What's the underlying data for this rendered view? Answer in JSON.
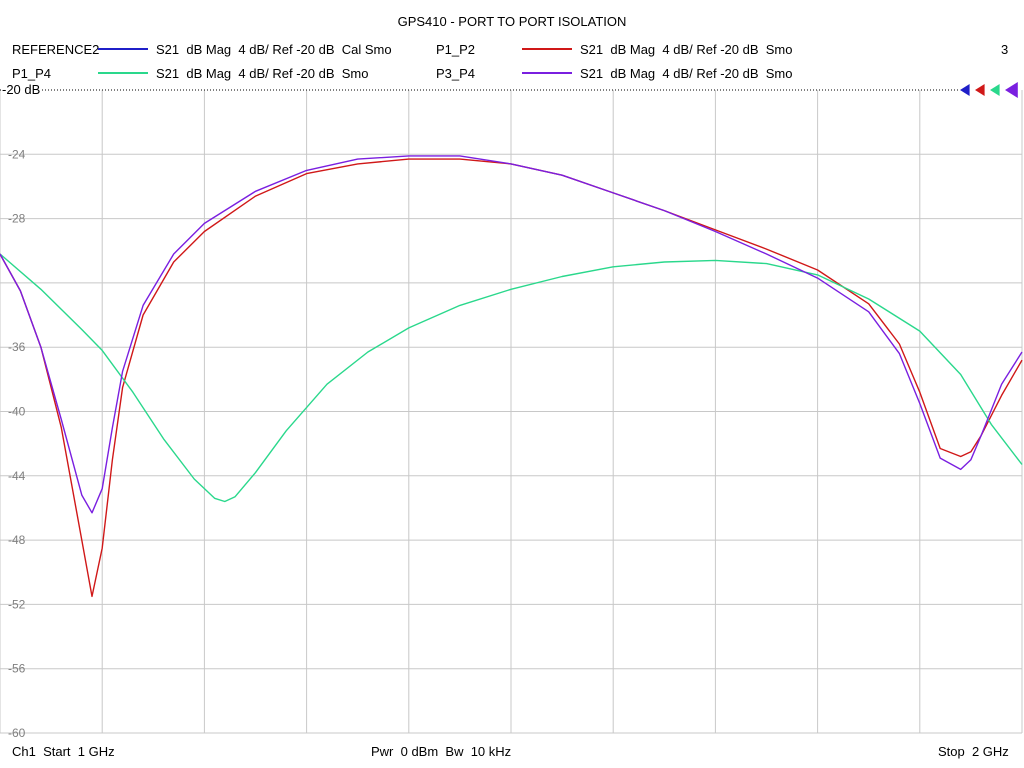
{
  "title": "GPS410 - PORT TO PORT ISOLATION",
  "channel_number": "3",
  "ref_label": "-20 dB",
  "legend": [
    {
      "name": "REFERENCE2",
      "desc": "S21  dB Mag  4 dB/ Ref -20 dB  Cal Smo",
      "color": "#1f1fc8"
    },
    {
      "name": "P1_P2",
      "desc": "S21  dB Mag  4 dB/ Ref -20 dB  Smo",
      "color": "#d01818"
    },
    {
      "name": "P1_P4",
      "desc": "S21  dB Mag  4 dB/ Ref -20 dB  Smo",
      "color": "#2ad88c"
    },
    {
      "name": "P3_P4",
      "desc": "S21  dB Mag  4 dB/ Ref -20 dB  Smo",
      "color": "#7a1fe0"
    }
  ],
  "footer": {
    "left": "Ch1  Start  1 GHz",
    "center": "Pwr  0 dBm  Bw  10 kHz",
    "right": "Stop  2 GHz"
  },
  "chart_data": {
    "type": "line",
    "title": "GPS410 - PORT TO PORT ISOLATION",
    "xlabel": "",
    "ylabel": "",
    "x_unit": "GHz",
    "xlim": [
      1.0,
      2.0
    ],
    "ylim": [
      -60,
      -20
    ],
    "y_ticks": [
      -20,
      -24,
      -28,
      -32,
      -36,
      -40,
      -44,
      -48,
      -52,
      -56,
      -60
    ],
    "y_tick_labels": [
      "-20",
      "-24",
      "-28",
      "",
      "-36",
      "-40",
      "-44",
      "-48",
      "-52",
      "-56",
      "-60"
    ],
    "x_gridlines": 10,
    "grid": true,
    "series": [
      {
        "name": "P1_P2",
        "color": "#d01818",
        "x": [
          1.0,
          1.02,
          1.04,
          1.06,
          1.08,
          1.09,
          1.1,
          1.11,
          1.12,
          1.14,
          1.17,
          1.2,
          1.25,
          1.3,
          1.35,
          1.4,
          1.45,
          1.5,
          1.55,
          1.6,
          1.65,
          1.7,
          1.75,
          1.8,
          1.85,
          1.88,
          1.9,
          1.92,
          1.94,
          1.95,
          1.96,
          1.98,
          2.0
        ],
        "y": [
          -30.2,
          -32.5,
          -36.0,
          -41.0,
          -48.0,
          -51.5,
          -48.5,
          -43.0,
          -38.5,
          -34.0,
          -30.7,
          -28.8,
          -26.6,
          -25.2,
          -24.6,
          -24.3,
          -24.3,
          -24.6,
          -25.3,
          -26.4,
          -27.5,
          -28.7,
          -29.9,
          -31.2,
          -33.3,
          -35.8,
          -38.8,
          -42.3,
          -42.8,
          -42.5,
          -41.5,
          -39.0,
          -36.8
        ]
      },
      {
        "name": "P1_P4",
        "color": "#2ad88c",
        "x": [
          1.0,
          1.04,
          1.08,
          1.1,
          1.13,
          1.16,
          1.19,
          1.21,
          1.22,
          1.23,
          1.25,
          1.28,
          1.32,
          1.36,
          1.4,
          1.45,
          1.5,
          1.55,
          1.6,
          1.65,
          1.7,
          1.75,
          1.8,
          1.85,
          1.9,
          1.94,
          1.97,
          2.0
        ],
        "y": [
          -30.2,
          -32.4,
          -34.9,
          -36.2,
          -38.8,
          -41.7,
          -44.2,
          -45.4,
          -45.6,
          -45.3,
          -43.8,
          -41.2,
          -38.3,
          -36.3,
          -34.8,
          -33.4,
          -32.4,
          -31.6,
          -31.0,
          -30.7,
          -30.6,
          -30.8,
          -31.5,
          -33.0,
          -35.0,
          -37.7,
          -40.8,
          -43.3
        ]
      },
      {
        "name": "P3_P4",
        "color": "#7a1fe0",
        "x": [
          1.0,
          1.02,
          1.04,
          1.06,
          1.08,
          1.09,
          1.1,
          1.11,
          1.12,
          1.14,
          1.17,
          1.2,
          1.25,
          1.3,
          1.35,
          1.4,
          1.45,
          1.5,
          1.55,
          1.6,
          1.65,
          1.7,
          1.75,
          1.8,
          1.85,
          1.88,
          1.9,
          1.92,
          1.94,
          1.95,
          1.96,
          1.98,
          2.0
        ],
        "y": [
          -30.2,
          -32.5,
          -36.0,
          -40.5,
          -45.2,
          -46.3,
          -44.8,
          -41.0,
          -37.5,
          -33.4,
          -30.2,
          -28.3,
          -26.3,
          -25.0,
          -24.3,
          -24.1,
          -24.1,
          -24.6,
          -25.3,
          -26.4,
          -27.5,
          -28.8,
          -30.2,
          -31.7,
          -33.8,
          -36.4,
          -39.5,
          -42.9,
          -43.6,
          -43.0,
          -41.5,
          -38.3,
          -36.3
        ]
      }
    ]
  }
}
